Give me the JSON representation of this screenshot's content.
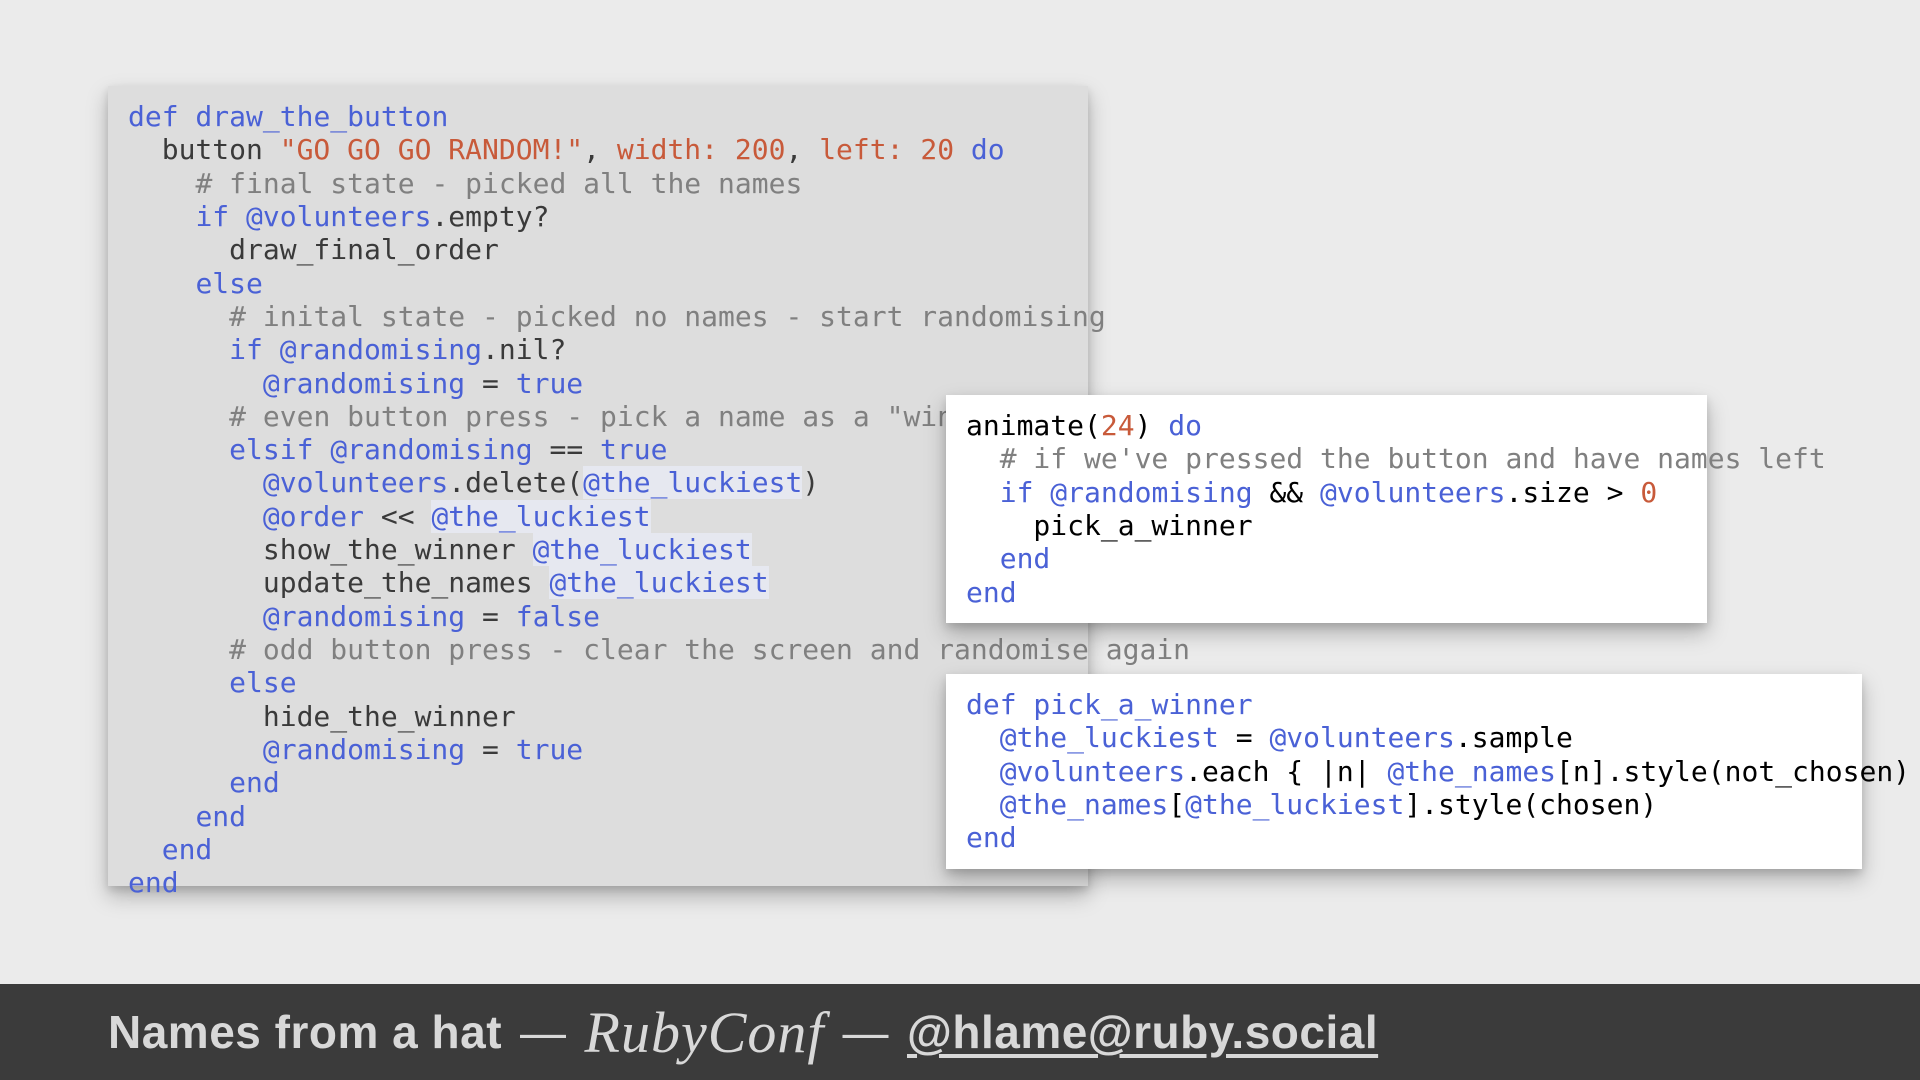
{
  "footer": {
    "title": "Names from a hat",
    "sep": "—",
    "conf": "RubyConf",
    "handle": "@hlame@ruby.social"
  },
  "code": {
    "main": {
      "l01a": "def",
      "l01b": " draw_the_button",
      "l02a": "  button ",
      "l02b": "\"GO GO GO RANDOM!\"",
      "l02c": ", ",
      "l02d": "width:",
      "l02e": " ",
      "l02f": "200",
      "l02g": ", ",
      "l02h": "left:",
      "l02i": " ",
      "l02j": "20",
      "l02k": " ",
      "l02l": "do",
      "l03a": "    ",
      "l03b": "# final state - picked all the names",
      "l04a": "    ",
      "l04b": "if",
      "l04c": " ",
      "l04d": "@volunteers",
      "l04e": ".empty?",
      "l05a": "      draw_final_order",
      "l06a": "    ",
      "l06b": "else",
      "l07a": "      ",
      "l07b": "# inital state - picked no names - start randomising",
      "l08a": "      ",
      "l08b": "if",
      "l08c": " ",
      "l08d": "@randomising",
      "l08e": ".nil?",
      "l09a": "        ",
      "l09b": "@randomising",
      "l09c": " = ",
      "l09d": "true",
      "l10a": "      ",
      "l10b": "# even button press - pick a name as a \"winner\"",
      "l11a": "      ",
      "l11b": "elsif",
      "l11c": " ",
      "l11d": "@randomising",
      "l11e": " == ",
      "l11f": "true",
      "l12a": "        ",
      "l12b": "@volunteers",
      "l12c": ".delete(",
      "l12d": "@the_luckiest",
      "l12e": ")",
      "l13a": "        ",
      "l13b": "@order",
      "l13c": " << ",
      "l13d": "@the_luckiest",
      "l14a": "        show_the_winner ",
      "l14b": "@the_luckiest",
      "l15a": "        update_the_names ",
      "l15b": "@the_luckiest",
      "l16a": "        ",
      "l16b": "@randomising",
      "l16c": " = ",
      "l16d": "false",
      "l17a": "      ",
      "l17b": "# odd button press - clear the screen and randomise again",
      "l18a": "      ",
      "l18b": "else",
      "l19a": "        hide_the_winner",
      "l20a": "        ",
      "l20b": "@randomising",
      "l20c": " = ",
      "l20d": "true",
      "l21a": "      ",
      "l21b": "end",
      "l22a": "    ",
      "l22b": "end",
      "l23a": "  ",
      "l23b": "end",
      "l24a": "end"
    },
    "s1": {
      "l01a": "animate(",
      "l01b": "24",
      "l01c": ") ",
      "l01d": "do",
      "l02a": "  ",
      "l02b": "# if we've pressed the button and have names left",
      "l03a": "  ",
      "l03b": "if",
      "l03c": " ",
      "l03d": "@randomising",
      "l03e": " && ",
      "l03f": "@volunteers",
      "l03g": ".size > ",
      "l03h": "0",
      "l04a": "    pick_a_winner",
      "l05a": "  ",
      "l05b": "end",
      "l06a": "end"
    },
    "s2": {
      "l01a": "def",
      "l01b": " pick_a_winner",
      "l02a": "  ",
      "l02b": "@the_luckiest",
      "l02c": " = ",
      "l02d": "@volunteers",
      "l02e": ".sample",
      "l03a": "  ",
      "l03b": "@volunteers",
      "l03c": ".each { |n| ",
      "l03d": "@the_names",
      "l03e": "[n].style(not_chosen) }",
      "l04a": "  ",
      "l04b": "@the_names",
      "l04c": "[",
      "l04d": "@the_luckiest",
      "l04e": "].style(chosen)",
      "l05a": "end"
    }
  }
}
